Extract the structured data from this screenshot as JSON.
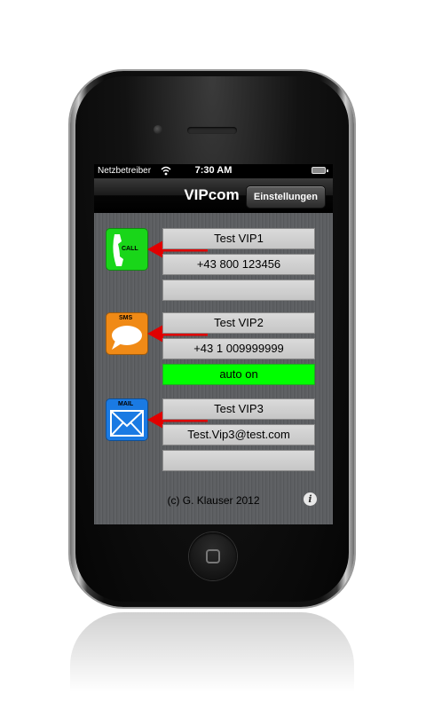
{
  "statusbar": {
    "carrier": "Netzbetreiber",
    "time": "7:30 AM",
    "wifi_icon": "wifi-icon",
    "battery_icon": "battery-icon"
  },
  "navbar": {
    "title": "VIPcom",
    "settings_label": "Einstellungen"
  },
  "contacts": [
    {
      "icon": "phone-call-icon",
      "icon_label": "CALL",
      "name": "Test VIP1",
      "value": "+43 800 123456",
      "status": ""
    },
    {
      "icon": "sms-bubble-icon",
      "icon_label": "SMS",
      "name": "Test VIP2",
      "value": "+43 1 009999999",
      "status": "auto on"
    },
    {
      "icon": "mail-envelope-icon",
      "icon_label": "MAIL",
      "name": "Test VIP3",
      "value": "Test.Vip3@test.com",
      "status": ""
    }
  ],
  "footer": {
    "copyright": "(c) G. Klauser 2012",
    "info_icon": "info-icon"
  },
  "colors": {
    "status_on": "#00ff00",
    "call_icon": "#19d619",
    "sms_icon": "#f08a16",
    "mail_icon": "#1a7ae3",
    "arrow": "#e00000"
  }
}
